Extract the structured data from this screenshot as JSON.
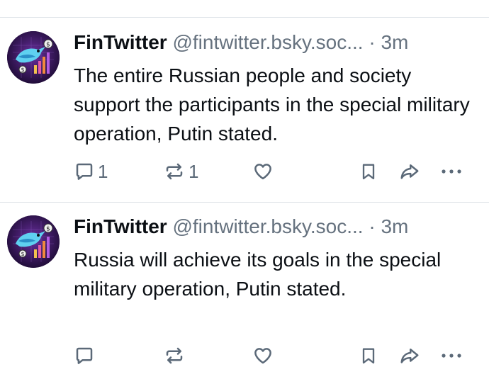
{
  "posts": [
    {
      "author": "FinTwitter",
      "handle": "@fintwitter.bsky.soc...",
      "separator": "·",
      "time": "3m",
      "text": "The entire Russian people and society support the participants in the special military operation, Putin stated.",
      "replies": "1",
      "reposts": "1",
      "likes": ""
    },
    {
      "author": "FinTwitter",
      "handle": "@fintwitter.bsky.soc...",
      "separator": "·",
      "time": "3m",
      "text": "Russia will achieve its goals in the special military operation, Putin stated.",
      "replies": "",
      "reposts": "",
      "likes": ""
    }
  ],
  "icons": [
    "avatar-bird",
    "reply-icon",
    "repost-icon",
    "like-icon",
    "bookmark-icon",
    "share-icon",
    "more-icon"
  ],
  "colors": {
    "text": "#0b0f14",
    "muted": "#66727f",
    "icon": "#5b6978",
    "divider": "#dfe3e8"
  }
}
